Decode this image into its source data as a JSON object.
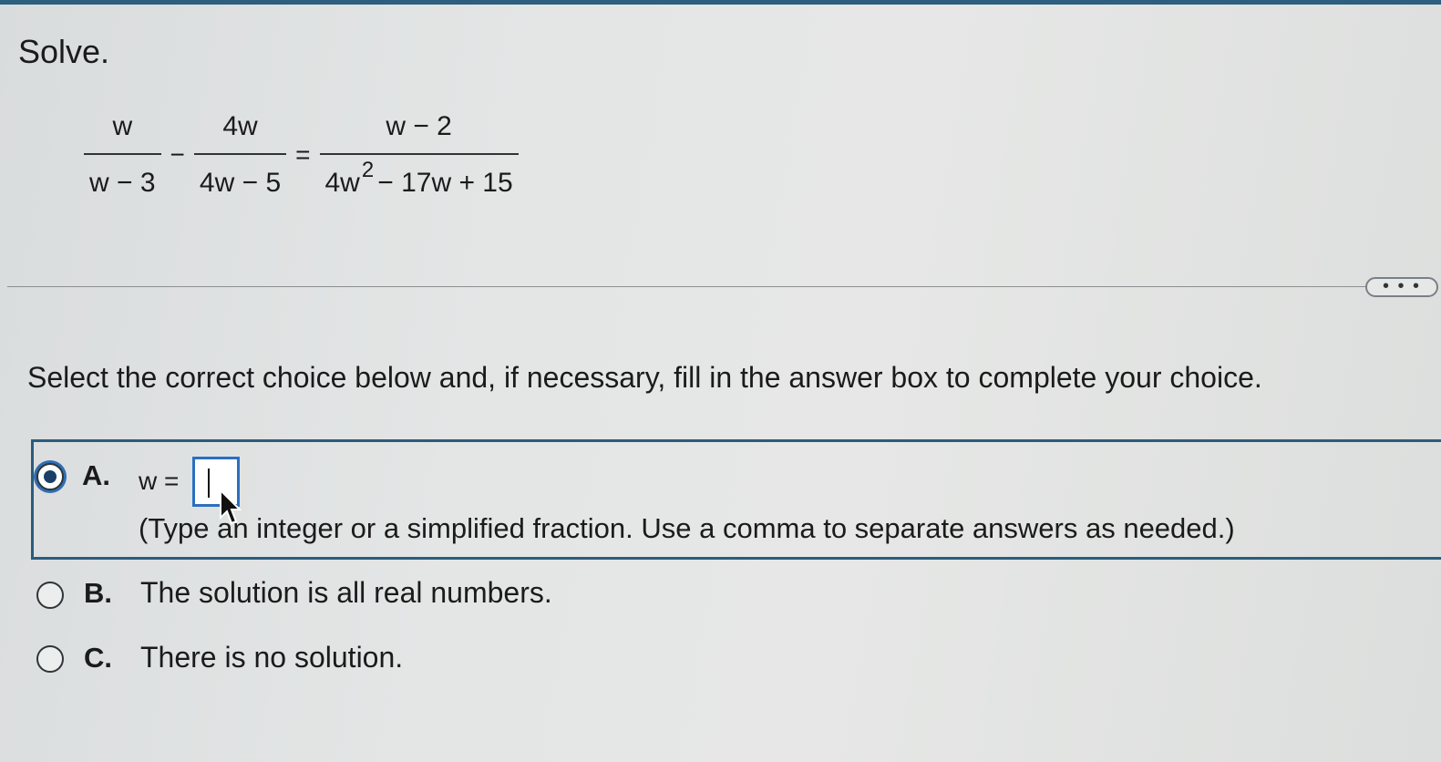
{
  "question": {
    "title": "Solve.",
    "equation": {
      "frac1": {
        "num": "w",
        "den": "w − 3"
      },
      "minus": "−",
      "frac2": {
        "num": "4w",
        "den": "4w − 5"
      },
      "equals": "=",
      "frac3": {
        "num": "w − 2",
        "den_part1": "4w",
        "den_exp": "2",
        "den_part2": "− 17w + 15"
      }
    }
  },
  "more_button": {
    "label": "• • •"
  },
  "instruction": "Select the correct choice below and, if necessary, fill in the answer box to complete your choice.",
  "choices": {
    "a": {
      "letter": "A.",
      "prefix": "w =",
      "answer_value": "",
      "hint": "(Type an integer or a simplified fraction. Use a comma to separate answers as needed.)",
      "selected": true
    },
    "b": {
      "letter": "B.",
      "text": "The solution is all real numbers.",
      "selected": false
    },
    "c": {
      "letter": "C.",
      "text": "There is no solution.",
      "selected": false
    }
  },
  "colors": {
    "accent": "#2b5c7c",
    "input_border": "#2b6fc0",
    "top_bar": "#2d5f7f"
  }
}
